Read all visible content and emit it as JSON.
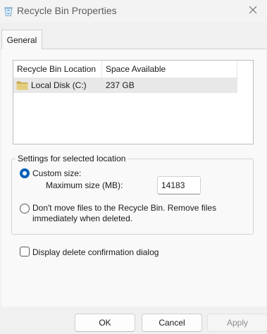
{
  "window": {
    "title": "Recycle Bin Properties"
  },
  "icons": {
    "app": "recycle-bin-icon",
    "close": "close-icon",
    "drive": "folder-icon"
  },
  "tabs": [
    {
      "label": "General",
      "selected": true
    }
  ],
  "locations": {
    "columns": [
      "Recycle Bin Location",
      "Space Available"
    ],
    "rows": [
      {
        "location": "Local Disk (C:)",
        "space": "237 GB",
        "selected": true
      }
    ]
  },
  "settings": {
    "group_label": "Settings for selected location",
    "custom_size_label": "Custom size:",
    "custom_size_selected": true,
    "max_size_label": "Maximum size (MB):",
    "max_size_value": "14183",
    "dont_move_line1": "Don't move files to the Recycle Bin. Remove files",
    "dont_move_line2": "immediately when deleted.",
    "dont_move_selected": false
  },
  "confirm": {
    "label": "Display delete confirmation dialog",
    "checked": false
  },
  "buttons": {
    "ok": "OK",
    "cancel": "Cancel",
    "apply": "Apply",
    "apply_enabled": false
  },
  "colors": {
    "accent": "#005fb8",
    "selection": "#e8e8e8",
    "folder": "#dcc77a"
  }
}
